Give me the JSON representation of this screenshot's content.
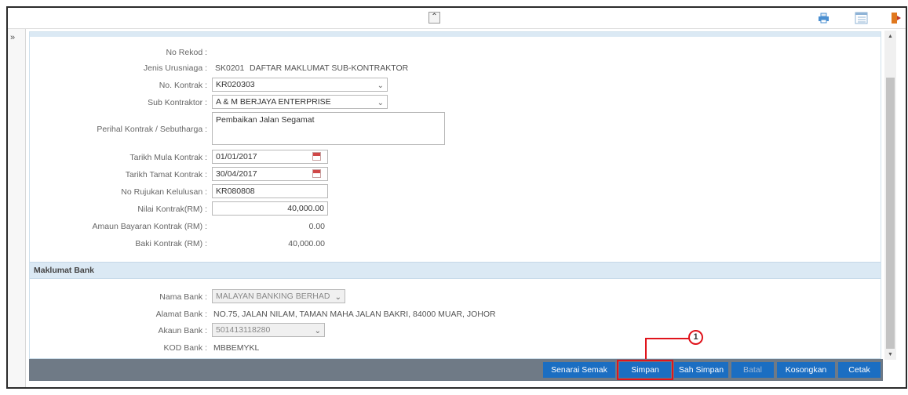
{
  "form": {
    "fields": [
      {
        "label": "No Rekod :",
        "value": ""
      },
      {
        "label": "Jenis Urusniaga :",
        "code": "SK0201",
        "value": "DAFTAR MAKLUMAT SUB-KONTRAKTOR"
      },
      {
        "label": "No. Kontrak :",
        "value": "KR020303"
      },
      {
        "label": "Sub Kontraktor :",
        "value": "A & M BERJAYA ENTERPRISE"
      },
      {
        "label": "Perihal Kontrak / Sebutharga :",
        "value": "Pembaikan Jalan Segamat"
      },
      {
        "label": "Tarikh Mula Kontrak :",
        "value": "01/01/2017"
      },
      {
        "label": "Tarikh Tamat Kontrak :",
        "value": "30/04/2017"
      },
      {
        "label": "No Rujukan Kelulusan :",
        "value": "KR080808"
      },
      {
        "label": "Nilai Kontrak(RM) :",
        "value": "40,000.00"
      },
      {
        "label": "Amaun Bayaran Kontrak (RM) :",
        "value": "0.00"
      },
      {
        "label": "Baki Kontrak (RM) :",
        "value": "40,000.00"
      }
    ]
  },
  "bank": {
    "title": "Maklumat Bank",
    "fields": [
      {
        "label": "Nama Bank :",
        "value": "MALAYAN BANKING BERHAD"
      },
      {
        "label": "Alamat Bank :",
        "value": "NO.75, JALAN NILAM, TAMAN MAHA JALAN BAKRI, 84000 MUAR, JOHOR"
      },
      {
        "label": "Akaun Bank :",
        "value": "501413118280"
      },
      {
        "label": "KOD Bank :",
        "value": "MBBEMYKL"
      }
    ]
  },
  "footer": {
    "buttons": [
      "Senarai Semak",
      "Simpan",
      "Sah Simpan",
      "Batal",
      "Kosongkan",
      "Cetak"
    ]
  },
  "toolbar": {
    "collapse_glyph": "≈",
    "left_toggle_glyph": "»",
    "icons": [
      "printer-icon",
      "list-icon",
      "logout-icon"
    ]
  },
  "callout": {
    "number": "1"
  },
  "colors": {
    "button": "#1b6ec2",
    "footer": "#6f7a86",
    "section": "#dbe9f4",
    "highlight": "#e0141c"
  }
}
